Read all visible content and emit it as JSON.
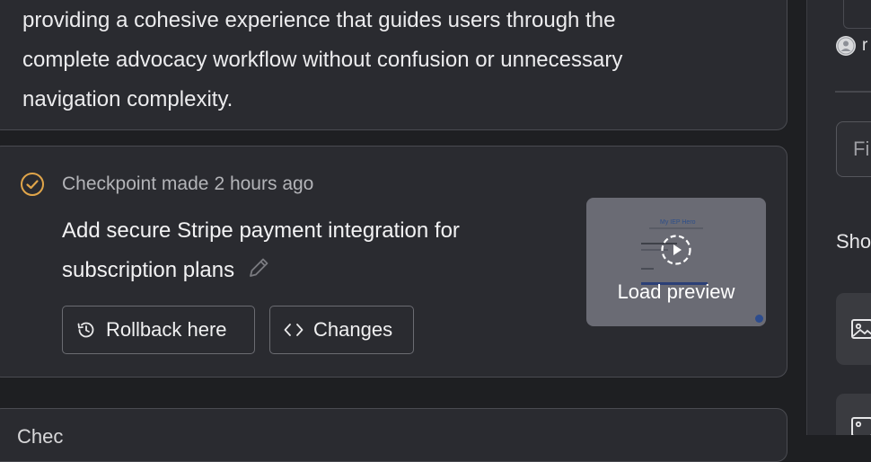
{
  "feed": {
    "top_card": {
      "lines": [
        "providing a cohesive experience that guides users through the",
        "complete advocacy workflow without confusion or unnecessary",
        "navigation complexity."
      ]
    },
    "checkpoint": {
      "label": "Checkpoint made",
      "time": "2 hours ago",
      "title_lines": [
        "Add secure Stripe payment integration for",
        "subscription plans"
      ],
      "rollback_label": "Rollback here",
      "changes_label": "Changes",
      "preview": {
        "load_label": "Load preview",
        "thumb_title": "My IEP Hero"
      }
    },
    "bottom_card": {
      "text": "Chec"
    }
  },
  "panel": {
    "avatar_text": "r",
    "filter_placeholder": "Fi",
    "heading": "Sho"
  },
  "colors": {
    "accent": "#e0a54a",
    "card_bg": "#2a2b30",
    "page_bg": "#1e1f22"
  }
}
